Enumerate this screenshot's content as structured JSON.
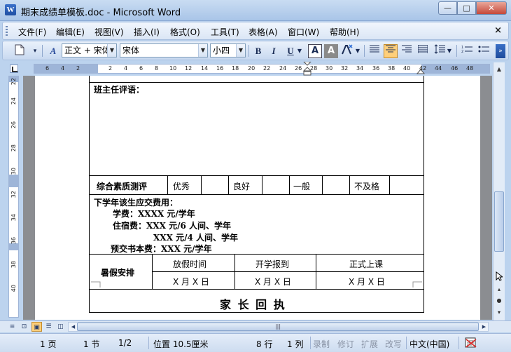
{
  "window": {
    "title": "期末成绩单模板.doc - Microsoft Word",
    "app_icon_letter": "W",
    "minimize": "—",
    "maximize": "□",
    "close": "✕"
  },
  "menu": {
    "items": [
      "文件(F)",
      "编辑(E)",
      "视图(V)",
      "插入(I)",
      "格式(O)",
      "工具(T)",
      "表格(A)",
      "窗口(W)",
      "帮助(H)"
    ],
    "close_doc": "×"
  },
  "toolbar": {
    "style_value": "正文 + 宋体",
    "font_value": "宋体",
    "size_value": "小四",
    "bold": "B",
    "italic": "I",
    "underline": "U",
    "highlight": "A",
    "font_color": "A",
    "align_active": "center"
  },
  "ruler": {
    "ticks": [
      "6",
      "4",
      "2",
      "2",
      "4",
      "6",
      "8",
      "10",
      "12",
      "14",
      "16",
      "18",
      "20",
      "22",
      "24",
      "26",
      "28",
      "30",
      "32",
      "34",
      "36",
      "38",
      "40",
      "42",
      "44",
      "46",
      "48"
    ],
    "vticks": [
      "22",
      "24",
      "26",
      "28",
      "30",
      "32",
      "34",
      "36",
      "38",
      "40"
    ]
  },
  "document": {
    "teacher_comment_label": "班主任评语：",
    "quality_label": "综合素质测评",
    "grades": [
      "优秀",
      "良好",
      "一般",
      "不及格"
    ],
    "fees_title": "下学年该生应交费用：",
    "fee_tuition": "学费：XXXX 元/学年",
    "fee_lodging_1": "住宿费：XXX 元/6 人间、学年",
    "fee_lodging_2": "XXX 元/4 人间、学年",
    "fee_books": "预交书本费：XXX 元/学年",
    "vacation_label": "暑假安排",
    "vacation_headers": [
      "放假时间",
      "开学报到",
      "正式上课"
    ],
    "vacation_dates": [
      "X 月 X 日",
      "X 月 X 日",
      "X 月 X 日"
    ],
    "parent_receipt": "家 长 回 执"
  },
  "status": {
    "page": "1 页",
    "section": "1 节",
    "page_of": "1/2",
    "position": "位置 10.5厘米",
    "line": "8 行",
    "column": "1 列",
    "rec": "录制",
    "trk": "修订",
    "ext": "扩展",
    "ovr": "改写",
    "language": "中文(中国)"
  }
}
